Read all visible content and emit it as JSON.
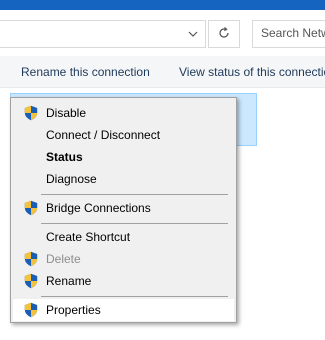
{
  "toolbar": {
    "search_placeholder": "Search Netw",
    "icons": {
      "dropdown": "chevron-down-icon",
      "refresh": "refresh-icon"
    }
  },
  "commands": {
    "rename_connection": "Rename this connection",
    "view_status": "View status of this connection"
  },
  "context_menu": {
    "items": [
      {
        "label": "Disable",
        "icon": "uac-shield-icon"
      },
      {
        "label": "Connect / Disconnect"
      },
      {
        "label": "Status",
        "style": "bold"
      },
      {
        "label": "Diagnose"
      },
      {
        "label": "Bridge Connections",
        "icon": "uac-shield-icon"
      },
      {
        "label": "Create Shortcut"
      },
      {
        "label": "Delete",
        "icon": "uac-shield-icon",
        "state": "disabled"
      },
      {
        "label": "Rename",
        "icon": "uac-shield-icon"
      },
      {
        "label": "Properties",
        "icon": "uac-shield-icon",
        "state": "hover"
      }
    ]
  },
  "colors": {
    "title_bar": "#1565c0",
    "selection": "#cce8ff",
    "menu_bg": "#f0f0f0",
    "hover_bg": "#ffffff",
    "disabled_text": "#8d8d8d"
  }
}
